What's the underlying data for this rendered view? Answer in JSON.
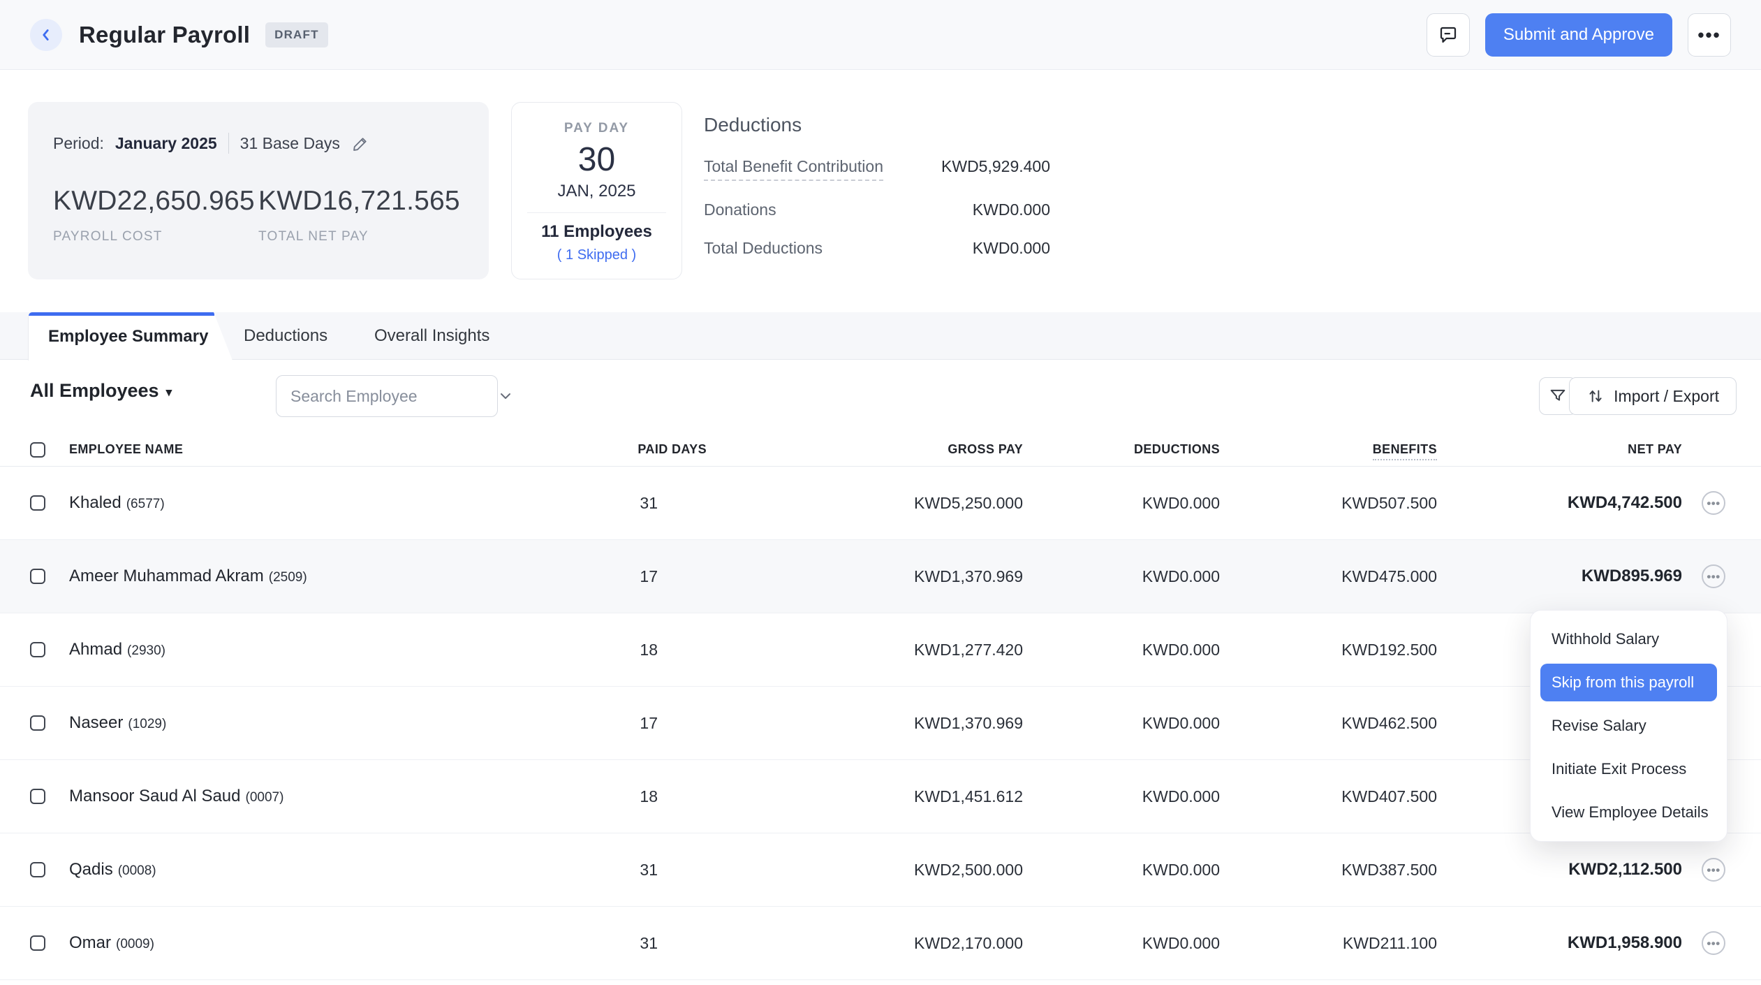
{
  "header": {
    "title": "Regular Payroll",
    "status_badge": "DRAFT",
    "submit_button": "Submit and Approve"
  },
  "summary": {
    "period_label": "Period:",
    "period_value": "January 2025",
    "base_days": "31 Base Days",
    "payroll_cost": "KWD22,650.965",
    "payroll_cost_label": "PAYROLL COST",
    "total_net_pay": "KWD16,721.565",
    "total_net_pay_label": "TOTAL NET PAY",
    "payday": {
      "label": "PAY DAY",
      "day": "30",
      "month_year": "JAN, 2025",
      "employees": "11 Employees",
      "skipped": "( 1 Skipped )"
    },
    "deductions": {
      "title": "Deductions",
      "rows": [
        {
          "label": "Total Benefit Contribution",
          "value": "KWD5,929.400"
        },
        {
          "label": "Donations",
          "value": "KWD0.000"
        },
        {
          "label": "Total Deductions",
          "value": "KWD0.000"
        }
      ]
    }
  },
  "tabs": [
    {
      "label": "Employee Summary",
      "active": true
    },
    {
      "label": "Deductions",
      "active": false
    },
    {
      "label": "Overall Insights",
      "active": false
    }
  ],
  "controls": {
    "filter_selected": "All Employees",
    "search_placeholder": "Search Employee",
    "import_export": "Import / Export"
  },
  "table": {
    "columns": [
      "EMPLOYEE NAME",
      "PAID DAYS",
      "GROSS PAY",
      "DEDUCTIONS",
      "BENEFITS",
      "NET PAY"
    ],
    "rows": [
      {
        "name": "Khaled",
        "id": "(6577)",
        "paid_days": "31",
        "gross": "KWD5,250.000",
        "deductions": "KWD0.000",
        "benefits": "KWD507.500",
        "net": "KWD4,742.500"
      },
      {
        "name": "Ameer Muhammad Akram",
        "id": "(2509)",
        "paid_days": "17",
        "gross": "KWD1,370.969",
        "deductions": "KWD0.000",
        "benefits": "KWD475.000",
        "net": "KWD895.969"
      },
      {
        "name": "Ahmad",
        "id": "(2930)",
        "paid_days": "18",
        "gross": "KWD1,277.420",
        "deductions": "KWD0.000",
        "benefits": "KWD192.500",
        "net": ""
      },
      {
        "name": "Naseer",
        "id": "(1029)",
        "paid_days": "17",
        "gross": "KWD1,370.969",
        "deductions": "KWD0.000",
        "benefits": "KWD462.500",
        "net": ""
      },
      {
        "name": "Mansoor Saud Al Saud",
        "id": "(0007)",
        "paid_days": "18",
        "gross": "KWD1,451.612",
        "deductions": "KWD0.000",
        "benefits": "KWD407.500",
        "net": ""
      },
      {
        "name": "Qadis",
        "id": "(0008)",
        "paid_days": "31",
        "gross": "KWD2,500.000",
        "deductions": "KWD0.000",
        "benefits": "KWD387.500",
        "net": "KWD2,112.500"
      },
      {
        "name": "Omar",
        "id": "(0009)",
        "paid_days": "31",
        "gross": "KWD2,170.000",
        "deductions": "KWD0.000",
        "benefits": "KWD211.100",
        "net": "KWD1,958.900"
      }
    ]
  },
  "context_menu": {
    "items": [
      {
        "label": "Withhold Salary",
        "highlighted": false
      },
      {
        "label": "Skip from this payroll",
        "highlighted": true
      },
      {
        "label": "Revise Salary",
        "highlighted": false
      },
      {
        "label": "Initiate Exit Process",
        "highlighted": false
      },
      {
        "label": "View Employee Details",
        "highlighted": false
      }
    ]
  },
  "colors": {
    "accent_blue": "#4e80f2",
    "tab_active_border": "#3e6cf0",
    "skipped_link": "#3f6cf0",
    "header_bg": "#f8f9fb",
    "card_bg": "#f3f4f7",
    "row_highlight": "#f7f8fa"
  },
  "icons": {
    "ellipsis": "•••",
    "caret_down": "▾"
  }
}
